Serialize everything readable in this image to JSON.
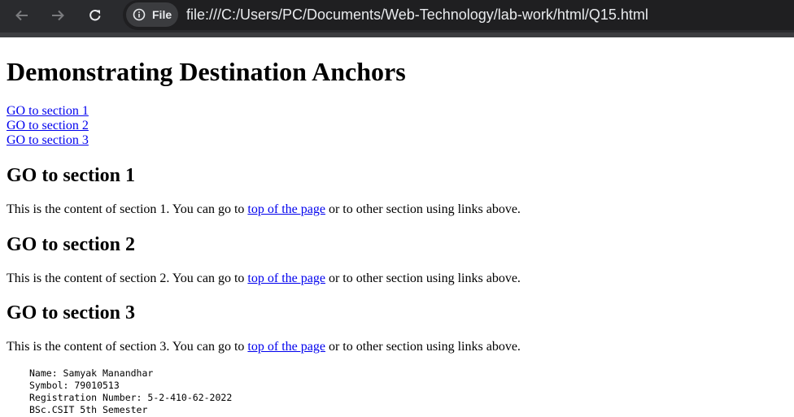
{
  "browser": {
    "back_icon": "arrow-left-icon",
    "forward_icon": "arrow-right-icon",
    "reload_icon": "reload-icon",
    "chip_icon": "info-icon",
    "chip_label": "File",
    "url": "file:///C:/Users/PC/Documents/Web-Technology/lab-work/html/Q15.html"
  },
  "page": {
    "heading": "Demonstrating Destination Anchors",
    "nav_links": [
      "GO to section 1",
      "GO to section 2",
      "GO to section 3"
    ],
    "sections": [
      {
        "title": "GO to section 1",
        "text_before": "This is the content of section 1. You can go to ",
        "link": "top of the page",
        "text_after": " or to other section using links above."
      },
      {
        "title": "GO to section 2",
        "text_before": "This is the content of section 2. You can go to ",
        "link": "top of the page",
        "text_after": " or to other section using links above."
      },
      {
        "title": "GO to section 3",
        "text_before": "This is the content of section 3. You can go to ",
        "link": "top of the page",
        "text_after": " or to other section using links above."
      }
    ],
    "footer_info": "Name: Samyak Manandhar\nSymbol: 79010513\nRegistration Number: 5-2-410-62-2022\nBSc.CSIT 5th Semester"
  }
}
